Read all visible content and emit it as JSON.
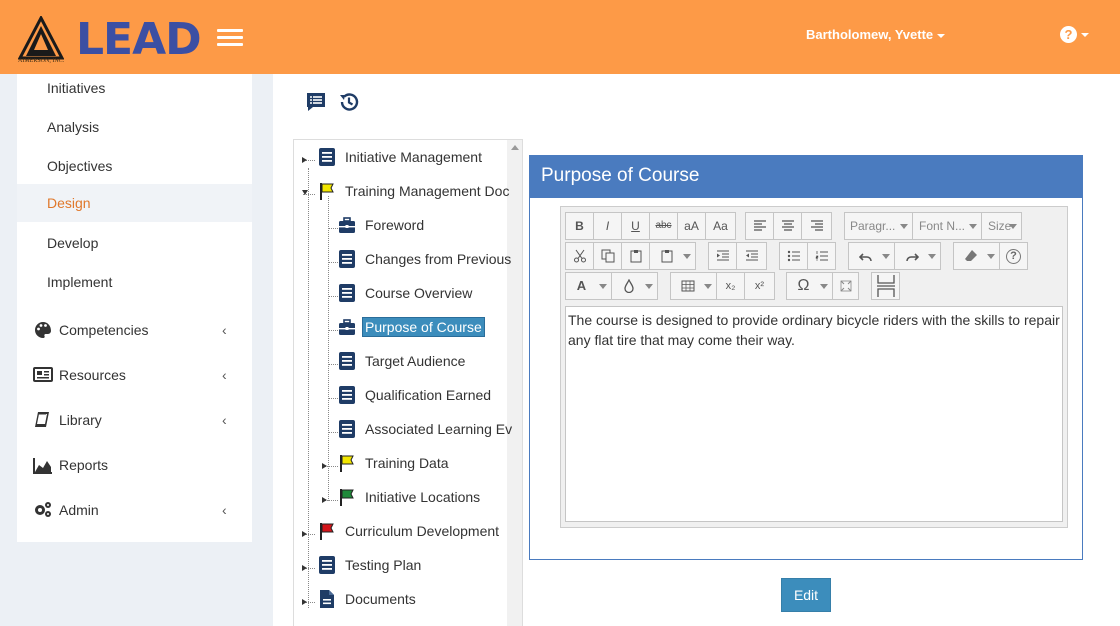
{
  "app": {
    "brand": "LEAD",
    "brand_sub": "AIMERSON, INC.",
    "user_name": "Bartholomew, Yvette",
    "help_icon": "question-circle-icon",
    "accent_color": "#fd9a47",
    "brand_color": "#3b4fa3"
  },
  "sidebar": {
    "sub_items": [
      {
        "label": "Initiatives"
      },
      {
        "label": "Analysis"
      },
      {
        "label": "Objectives"
      },
      {
        "label": "Design",
        "active": true
      },
      {
        "label": "Develop"
      },
      {
        "label": "Implement"
      }
    ],
    "nav_items": [
      {
        "label": "Competencies",
        "icon": "palette-icon",
        "has_children": true
      },
      {
        "label": "Resources",
        "icon": "newspaper-icon",
        "has_children": true
      },
      {
        "label": "Library",
        "icon": "book-icon",
        "has_children": true
      },
      {
        "label": "Reports",
        "icon": "area-chart-icon",
        "has_children": false
      },
      {
        "label": "Admin",
        "icon": "cogs-icon",
        "has_children": true
      }
    ]
  },
  "toolbar": {
    "list_icon": "comment-list-icon",
    "history_icon": "history-icon"
  },
  "tree": {
    "nodes": [
      {
        "label": "Initiative Management",
        "icon": "document-icon"
      },
      {
        "label": "Training Management Doc",
        "icon": "yellow-flag-icon"
      },
      {
        "label": "Foreword",
        "icon": "briefcase-icon"
      },
      {
        "label": "Changes from Previous",
        "icon": "document-icon"
      },
      {
        "label": "Course Overview",
        "icon": "document-icon"
      },
      {
        "label": "Purpose of Course",
        "icon": "briefcase-icon",
        "selected": true
      },
      {
        "label": "Target Audience",
        "icon": "document-icon"
      },
      {
        "label": "Qualification Earned",
        "icon": "document-icon"
      },
      {
        "label": "Associated Learning Ev",
        "icon": "document-icon"
      },
      {
        "label": "Training Data",
        "icon": "yellow-flag-icon"
      },
      {
        "label": "Initiative Locations",
        "icon": "green-flag-icon"
      },
      {
        "label": "Curriculum Development",
        "icon": "red-flag-icon"
      },
      {
        "label": "Testing Plan",
        "icon": "document-icon"
      },
      {
        "label": "Documents",
        "icon": "file-icon"
      }
    ]
  },
  "content": {
    "title": "Purpose of Course",
    "editor_toolbar": {
      "bold": "B",
      "italic": "I",
      "underline": "U",
      "strikethrough": "abc",
      "upper_lower": "aA",
      "capitalize": "Aa",
      "paragraph": "Paragr...",
      "font_name": "Font N...",
      "size": "Size",
      "font_color": "A",
      "subscript": "x₂",
      "superscript": "x²",
      "special_char": "Ω"
    },
    "body_text": "The course is designed to provide ordinary bicycle riders with the skills to repair any flat tire that may come their way.",
    "edit_button": "Edit"
  }
}
